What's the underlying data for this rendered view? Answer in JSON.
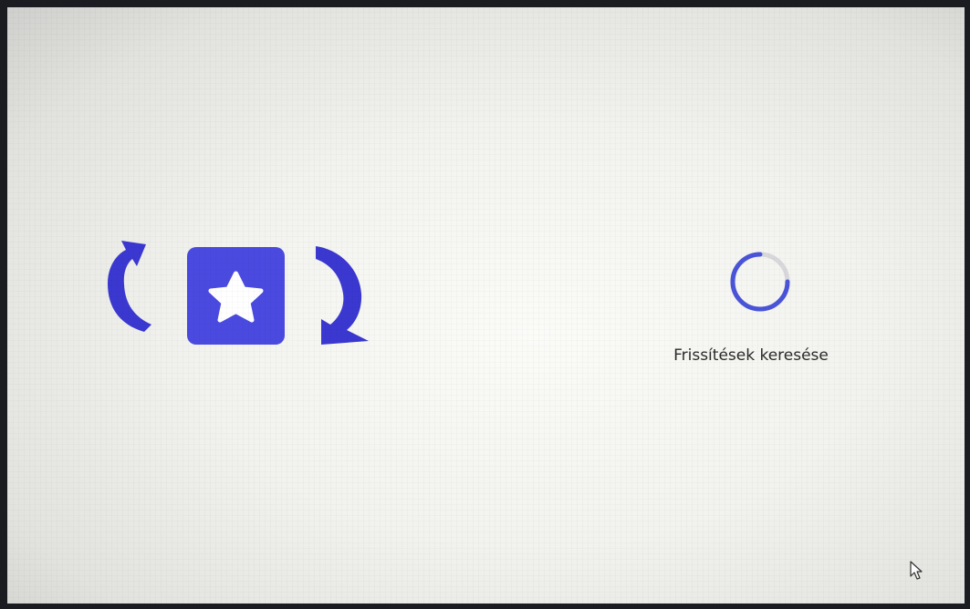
{
  "status": {
    "text": "Frissítések keresése"
  },
  "icons": {
    "illustration": "update-star-illustration",
    "spinner": "loading-spinner-icon",
    "cursor": "mouse-pointer-icon"
  },
  "colors": {
    "accent": "#4a4ae0",
    "accent_dark": "#3a38d0",
    "spinner_track": "#d8d8dc",
    "spinner_arc": "#4a54d8",
    "text": "#2a2a2a"
  }
}
